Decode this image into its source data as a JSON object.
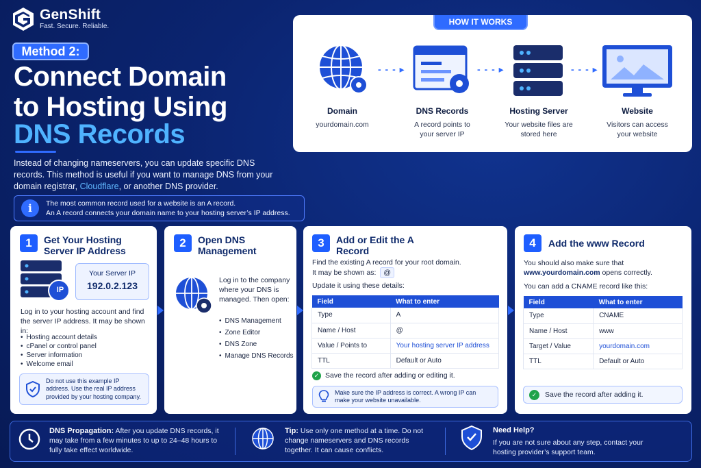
{
  "brand": {
    "name": "GenShift",
    "tagline": "Fast. Secure. Reliable."
  },
  "header": {
    "method_badge": "Method 2:",
    "title_line1": "Connect Domain",
    "title_line2": "to Hosting Using",
    "title_line3": "DNS Records",
    "intro_part1": "Instead of changing nameservers, you can update specific DNS records. This method is useful if you want to manage DNS from your domain registrar, ",
    "intro_highlight": "Cloudflare",
    "intro_part2": ", or another DNS provider.",
    "info_line1": "The most common record used for a website is an A record.",
    "info_line2": "An A record connects your domain name to your hosting server’s IP address."
  },
  "how_it_works": {
    "badge": "HOW IT WORKS",
    "steps": [
      {
        "title": "Domain",
        "sub": "yourdomain.com"
      },
      {
        "title": "DNS Records",
        "sub": "A record points to your server IP"
      },
      {
        "title": "Hosting Server",
        "sub": "Your website files are stored here"
      },
      {
        "title": "Website",
        "sub": "Visitors can access your website"
      }
    ]
  },
  "step1": {
    "num": "1",
    "title": "Get Your Hosting Server IP Address",
    "ip_label": "Your Server IP",
    "ip_value": "192.0.2.123",
    "ip_badge": "IP",
    "text": "Log in to your hosting account and find the server IP address. It may be shown in:",
    "items": [
      "Hosting account details",
      "cPanel or control panel",
      "Server information",
      "Welcome email"
    ],
    "warning": "Do not use this example IP address. Use the real IP address provided by your hosting company."
  },
  "step2": {
    "num": "2",
    "title": "Open DNS Management",
    "text": "Log in to the company where your DNS is managed. Then open:",
    "items": [
      "DNS Management",
      "Zone Editor",
      "DNS Zone",
      "Manage DNS Records"
    ]
  },
  "step3": {
    "num": "3",
    "title": "Add or Edit the A Record",
    "text1": "Find the existing A record for your root domain.",
    "text2": "It may be shown as:",
    "at": "@",
    "text3": "Update it using these details:",
    "table_headers": [
      "Field",
      "What to enter"
    ],
    "rows": [
      [
        "Type",
        "A"
      ],
      [
        "Name / Host",
        "@"
      ],
      [
        "Value / Points to",
        "Your hosting server IP address"
      ],
      [
        "TTL",
        "Default or Auto"
      ]
    ],
    "save_note": "Save the record after adding or editing it.",
    "tip": "Make sure the IP address is correct. A wrong IP can make your website unavailable."
  },
  "step4": {
    "num": "4",
    "title": "Add the www Record",
    "text1": "You should also make sure that",
    "www_domain": "www.yourdomain.com",
    "text2": " opens correctly.",
    "text3": "You can add a CNAME record like this:",
    "table_headers": [
      "Field",
      "What to enter"
    ],
    "rows": [
      [
        "Type",
        "CNAME"
      ],
      [
        "Name / Host",
        "www"
      ],
      [
        "Target / Value",
        "yourdomain.com"
      ],
      [
        "TTL",
        "Default or Auto"
      ]
    ],
    "save_note": "Save the record after adding it."
  },
  "bottom": {
    "propagation_title": "DNS Propagation:",
    "propagation_text": " After you update DNS records, it may take from a few minutes to up to 24–48 hours to fully take effect worldwide.",
    "tip_title": "Tip:",
    "tip_text": " Use only one method at a time. Do not change nameservers and DNS records together. It can cause conflicts.",
    "help_title": "Need Help?",
    "help_text": "If you are not sure about any step, contact your hosting provider’s support team."
  },
  "colors": {
    "accent": "#2f6bff",
    "background": "#0b2470",
    "highlight": "#4fb3ff",
    "success": "#1fa34a"
  }
}
